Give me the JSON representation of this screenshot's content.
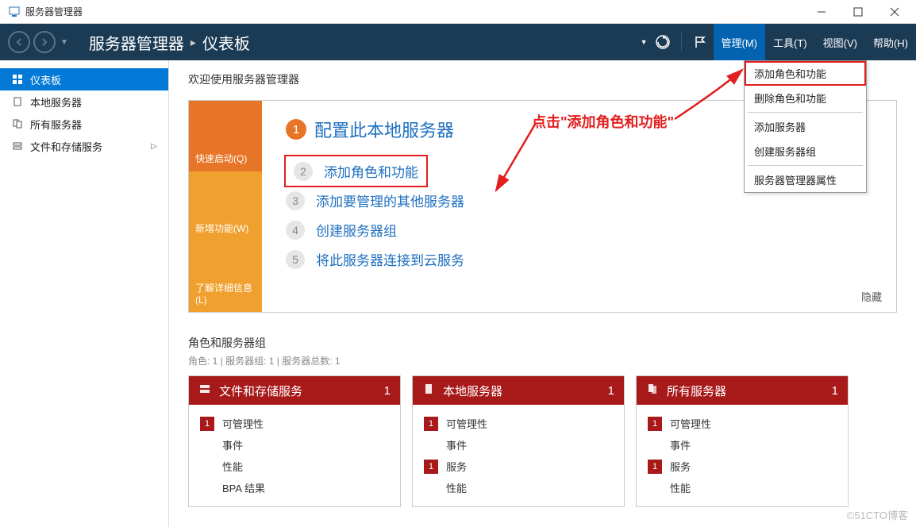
{
  "window": {
    "title": "服务器管理器"
  },
  "header": {
    "breadcrumb1": "服务器管理器",
    "breadcrumb2": "仪表板",
    "menu": {
      "manage": "管理(M)",
      "tools": "工具(T)",
      "view": "视图(V)",
      "help": "帮助(H)"
    }
  },
  "dropdown": {
    "add_roles": "添加角色和功能",
    "remove_roles": "删除角色和功能",
    "add_server": "添加服务器",
    "create_group": "创建服务器组",
    "properties": "服务器管理器属性"
  },
  "sidebar": {
    "dashboard": "仪表板",
    "local_server": "本地服务器",
    "all_servers": "所有服务器",
    "file_storage": "文件和存储服务"
  },
  "welcome": {
    "title": "欢迎使用服务器管理器",
    "tabs": {
      "quickstart": "快速启动(Q)",
      "whatsnew": "新增功能(W)",
      "learnmore": "了解详细信息(L)"
    },
    "config_heading": "配置此本地服务器",
    "steps": {
      "s2": "添加角色和功能",
      "s3": "添加要管理的其他服务器",
      "s4": "创建服务器组",
      "s5": "将此服务器连接到云服务"
    },
    "hide": "隐藏"
  },
  "groups": {
    "title": "角色和服务器组",
    "subtitle": "角色: 1 | 服务器组: 1 | 服务器总数: 1"
  },
  "tiles": [
    {
      "title": "文件和存储服务",
      "count": "1",
      "rows": [
        {
          "badge": "1",
          "label": "可管理性"
        },
        {
          "badge": "",
          "label": "事件"
        },
        {
          "badge": "",
          "label": "性能"
        },
        {
          "badge": "",
          "label": "BPA 结果"
        }
      ]
    },
    {
      "title": "本地服务器",
      "count": "1",
      "rows": [
        {
          "badge": "1",
          "label": "可管理性"
        },
        {
          "badge": "",
          "label": "事件"
        },
        {
          "badge": "1",
          "label": "服务"
        },
        {
          "badge": "",
          "label": "性能"
        }
      ]
    },
    {
      "title": "所有服务器",
      "count": "1",
      "rows": [
        {
          "badge": "1",
          "label": "可管理性"
        },
        {
          "badge": "",
          "label": "事件"
        },
        {
          "badge": "1",
          "label": "服务"
        },
        {
          "badge": "",
          "label": "性能"
        }
      ]
    }
  ],
  "annotation": {
    "text": "点击\"添加角色和功能\""
  },
  "watermark": "©51CTO博客"
}
